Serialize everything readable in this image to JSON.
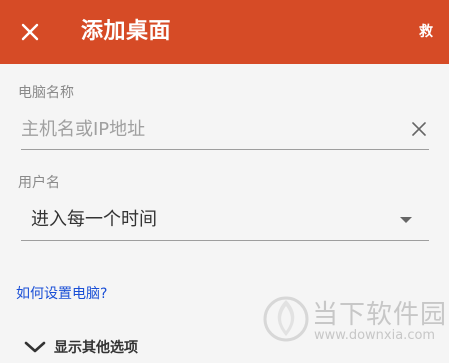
{
  "header": {
    "close_icon": "close-icon",
    "title": "添加桌面",
    "save_label": "救",
    "background_color": "#d64b26"
  },
  "form": {
    "pc_name": {
      "label": "电脑名称",
      "value": "",
      "placeholder": "主机名或IP地址",
      "clear_icon": "clear-icon"
    },
    "username": {
      "label": "用户名",
      "selected": "进入每一个时间",
      "dropdown_icon": "dropdown-arrow-icon"
    }
  },
  "help_link": "如何设置电脑?",
  "more_options": {
    "label": "显示其他选项",
    "icon": "chevron-down-icon"
  },
  "watermark": {
    "title": "当下软件园",
    "url": "www.downxia.com"
  }
}
